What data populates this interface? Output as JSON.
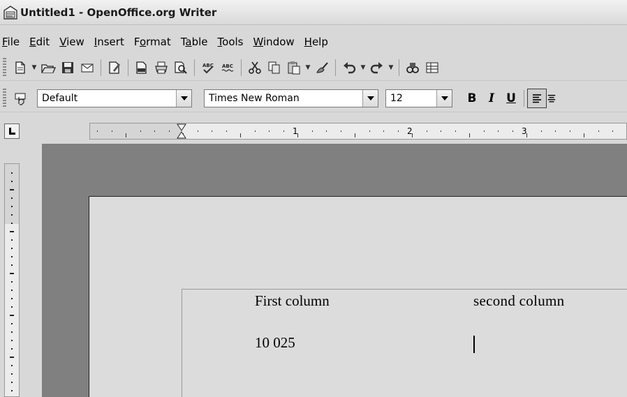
{
  "window": {
    "title": "Untitled1 - OpenOffice.org Writer"
  },
  "menubar": {
    "items": [
      {
        "label": "File",
        "mnemonic": "F",
        "rest": "ile"
      },
      {
        "label": "Edit",
        "mnemonic": "E",
        "rest": "dit"
      },
      {
        "label": "View",
        "mnemonic": "V",
        "rest": "iew"
      },
      {
        "label": "Insert",
        "mnemonic": "I",
        "rest": "nsert"
      },
      {
        "label": "Format",
        "mnemonic": "F",
        "rest": "ormat",
        "pre": ""
      },
      {
        "label": "Table",
        "mnemonic": "a",
        "rest": "ble",
        "pre": "T"
      },
      {
        "label": "Tools",
        "mnemonic": "T",
        "rest": "ools"
      },
      {
        "label": "Window",
        "mnemonic": "W",
        "rest": "indow"
      },
      {
        "label": "Help",
        "mnemonic": "H",
        "rest": "elp"
      }
    ]
  },
  "standard_toolbar": {
    "icons": [
      "new-document-icon",
      "open-folder-icon",
      "save-icon",
      "email-icon",
      "edit-file-icon",
      "export-pdf-icon",
      "print-icon",
      "page-preview-icon",
      "spellcheck-icon",
      "autospellcheck-icon",
      "cut-icon",
      "copy-icon",
      "paste-icon",
      "format-paintbrush-icon",
      "undo-icon",
      "redo-icon",
      "navigator-icon",
      "table-icon"
    ]
  },
  "formatting_toolbar": {
    "paragraph_style": "Default",
    "font_name": "Times New Roman",
    "font_size": "12",
    "bold_label": "B",
    "italic_label": "I",
    "underline_label": "U",
    "align_left_active": true
  },
  "ruler": {
    "numbers": [
      "1",
      "2",
      "3"
    ]
  },
  "document": {
    "rows": [
      [
        "First column",
        "second column"
      ],
      [
        "10 025",
        ""
      ]
    ]
  }
}
